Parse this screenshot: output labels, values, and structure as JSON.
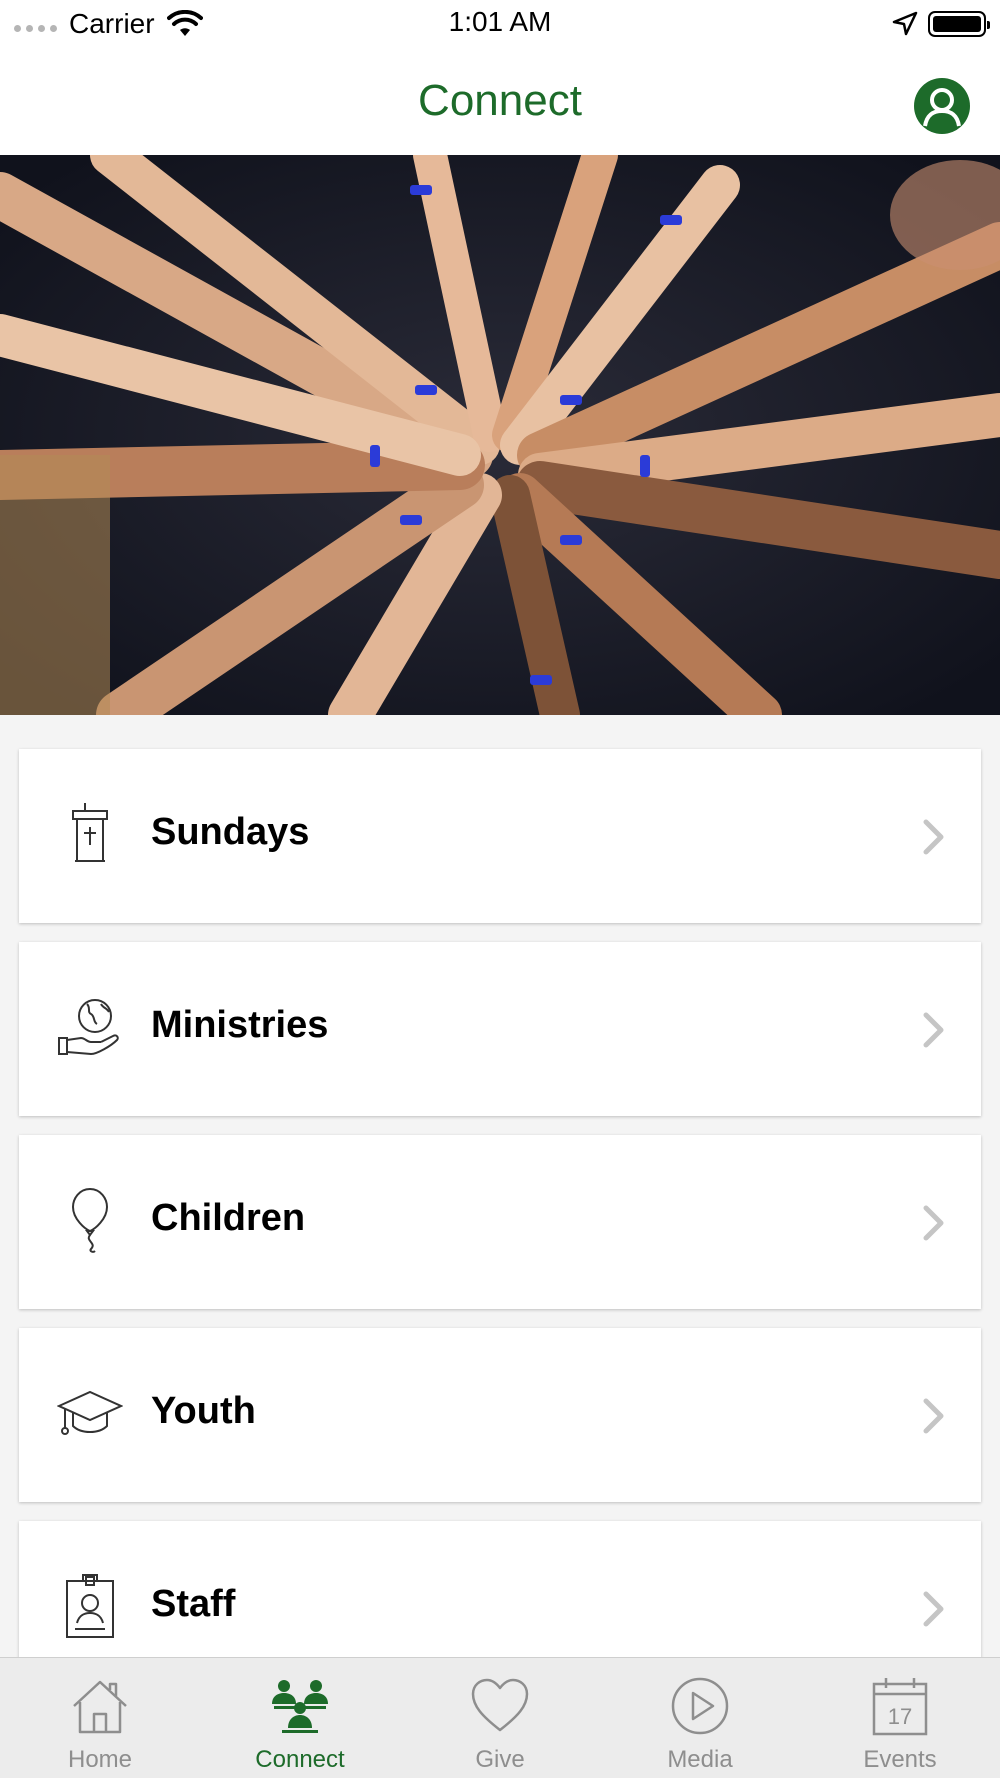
{
  "status_bar": {
    "carrier": "Carrier",
    "time": "1:01 AM"
  },
  "nav": {
    "title": "Connect"
  },
  "colors": {
    "brand_green": "#1d6b2a",
    "inactive_gray": "#8e8e8e"
  },
  "list": {
    "items": [
      {
        "label": "Sundays",
        "icon": "pulpit-icon"
      },
      {
        "label": "Ministries",
        "icon": "globe-in-hand-icon"
      },
      {
        "label": "Children",
        "icon": "balloon-icon"
      },
      {
        "label": "Youth",
        "icon": "graduation-cap-icon"
      },
      {
        "label": "Staff",
        "icon": "id-badge-icon"
      }
    ]
  },
  "tabs": [
    {
      "label": "Home",
      "icon": "house-icon",
      "active": false
    },
    {
      "label": "Connect",
      "icon": "people-icon",
      "active": true
    },
    {
      "label": "Give",
      "icon": "heart-icon",
      "active": false
    },
    {
      "label": "Media",
      "icon": "play-circle-icon",
      "active": false
    },
    {
      "label": "Events",
      "icon": "calendar-icon",
      "active": false,
      "badge": "17"
    }
  ]
}
